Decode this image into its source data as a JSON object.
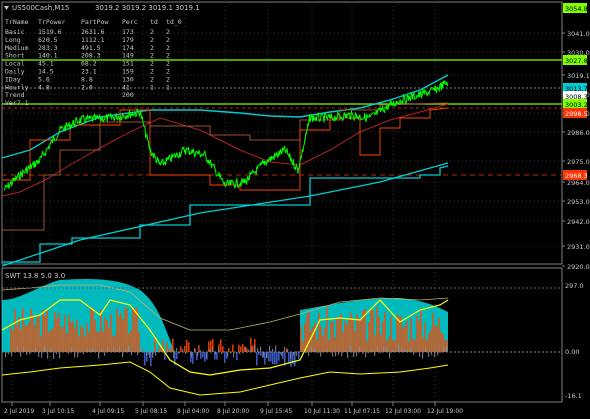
{
  "window": {
    "symbol_title": "US500Cash,M15",
    "ohlc": "3019.2 3019.2 3019.1 3019.1"
  },
  "main_price_axis": {
    "ticks": [
      "3041.0",
      "3030.0",
      "3019.1",
      "3008.0",
      "2997.0",
      "2986.0",
      "2975.0",
      "2964.0",
      "2953.0",
      "2942.0",
      "2931.0",
      "2920.0"
    ],
    "badges": [
      {
        "label": "3054.8",
        "color": "#7fff00",
        "text_color": "#000"
      },
      {
        "label": "3027.8",
        "color": "#7fff00",
        "text_color": "#000"
      },
      {
        "label": "3013.7",
        "color": "#00ced1",
        "text_color": "#000"
      },
      {
        "label": "3008.3",
        "color": "#ffffff",
        "text_color": "#000"
      },
      {
        "label": "3003.2",
        "color": "#7fff00",
        "text_color": "#000"
      },
      {
        "label": "2998.5",
        "color": "#ff3300",
        "text_color": "#fff"
      },
      {
        "label": "2968.3",
        "color": "#ff3300",
        "text_color": "#fff"
      }
    ]
  },
  "trend_table": {
    "headers": [
      "TrName",
      "TrPower",
      "PartPow",
      "Perc",
      "td",
      "td_0"
    ],
    "rows": [
      [
        "Basic",
        "1519.6",
        "2631.6",
        "173",
        "2",
        "2"
      ],
      [
        "Long",
        "620.5",
        "1112.1",
        "179",
        "2",
        "2"
      ],
      [
        "Medium",
        "283.3",
        "491.5",
        "174",
        "2",
        "2"
      ],
      [
        "Short",
        "140.1",
        "208.3",
        "149",
        "2",
        "2"
      ],
      [
        "Local",
        "45.1",
        "68.2",
        "151",
        "2",
        "2"
      ],
      [
        "Daily",
        "14.5",
        "23.1",
        "159",
        "2",
        "2"
      ],
      [
        "IDay",
        "5.6",
        "8.8",
        "130",
        "2",
        "2"
      ],
      [
        "Hourly",
        "4.8",
        "2.0",
        "41",
        "1",
        "1"
      ],
      [
        "Trend",
        "",
        "",
        "200",
        "",
        ""
      ],
      [
        "Ver7.1",
        "",
        "",
        "",
        "",
        ""
      ]
    ]
  },
  "sub_window": {
    "title": "SWT 13.8 5.0 3.0",
    "ticks": [
      "297.0",
      "0.00",
      "-16.1"
    ]
  },
  "time_axis": {
    "labels": [
      "2 Jul 2019",
      "3 Jul 10:15",
      "4 Jul 09:15",
      "5 Jul 08:15",
      "8 Jul 04:00",
      "8 Jul 20:00",
      "9 Jul 15:45",
      "10 Jul 11:30",
      "11 Jul 07:15",
      "12 Jul 03:00",
      "12 Jul 19:00"
    ]
  },
  "colors": {
    "background": "#000000",
    "price_line": "#00ff00",
    "channel_upper": "#00ced1",
    "support_red": "#ff3300",
    "level_green": "#7fff00",
    "grid": "#404040",
    "osc_cyan": "#00ced1",
    "osc_orange": "#ff4500",
    "osc_yellow": "#ffff00",
    "osc_blue": "#4169e1"
  }
}
